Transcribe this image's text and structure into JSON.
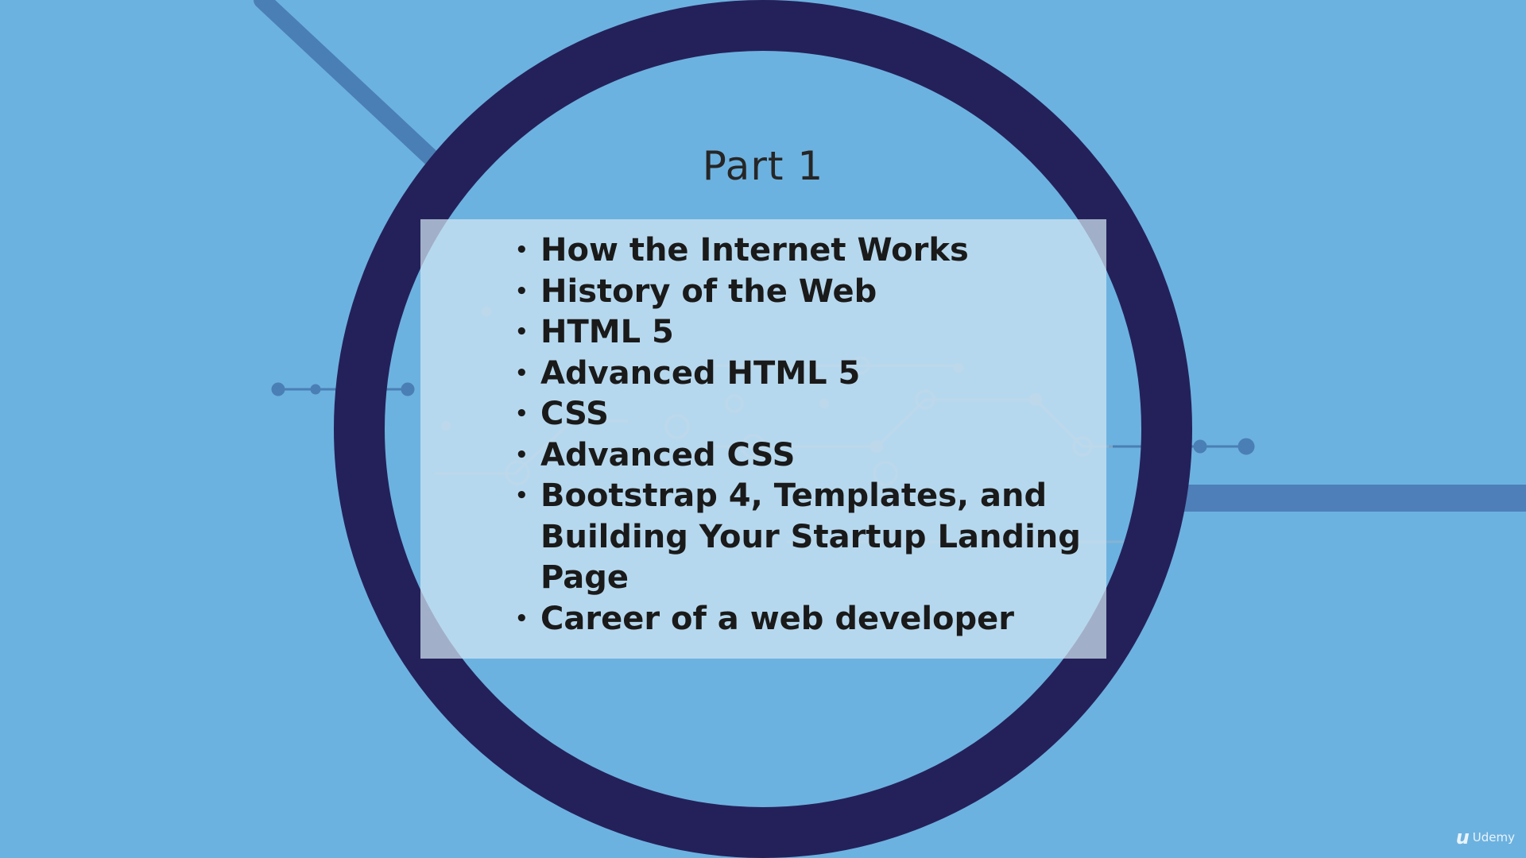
{
  "slide": {
    "title": "Part 1",
    "topics": [
      "How the Internet Works",
      "History of the Web",
      "HTML 5",
      "Advanced HTML 5",
      "CSS",
      "Advanced CSS",
      "Bootstrap 4, Templates, and Building Your Startup Landing Page",
      "Career of a web developer"
    ],
    "bullet_glyph": "•"
  },
  "brand": {
    "logo_icon": "udemy-logo-icon",
    "logo_mark": "u",
    "name": "Udemy"
  },
  "colors": {
    "background": "#6cb2e0",
    "ring": "#24215a",
    "panel": "#d2e6f3",
    "text": "#1a1a1a",
    "circuit_lines": "#4a7fb5"
  }
}
